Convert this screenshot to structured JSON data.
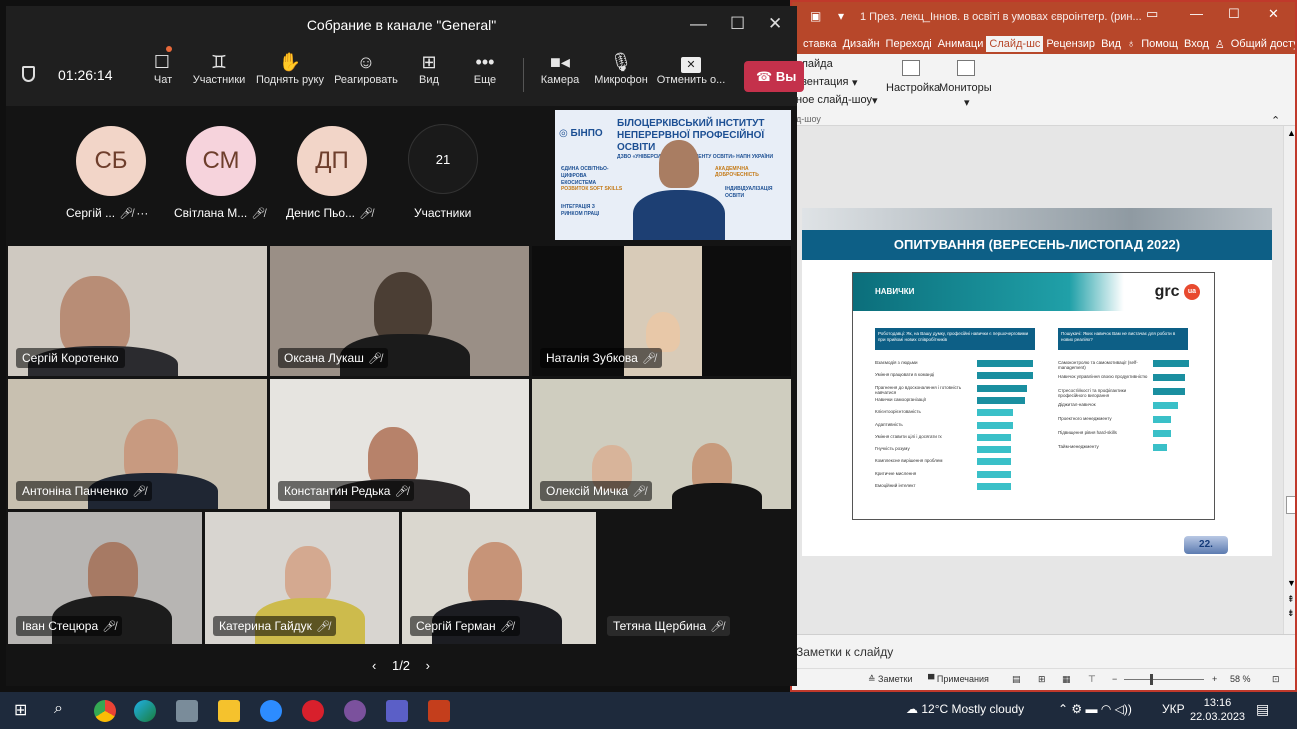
{
  "teams": {
    "title": "Собрание в канале \"General\"",
    "timer": "01:26:14",
    "toolbar": {
      "chat": "Чат",
      "participants": "Участники",
      "raise_hand": "Поднять руку",
      "react": "Реагировать",
      "view": "Вид",
      "more": "Еще",
      "camera": "Камера",
      "mic": "Микрофон",
      "share": "Отменить о...",
      "leave": "Вы"
    },
    "avatars": [
      {
        "initials": "СБ",
        "name": "Сергій ...",
        "color": "#f2d5c8"
      },
      {
        "initials": "СМ",
        "name": "Світлана М...",
        "color": "#f6d3dc"
      },
      {
        "initials": "ДП",
        "name": "Денис Пьо...",
        "color": "#f2d5c8"
      }
    ],
    "overflow": {
      "count": "21",
      "label": "Участники"
    },
    "banner": {
      "org_short": "БІНПО",
      "org_line1": "БІЛОЦЕРКІВСЬКИЙ ІНСТИТУТ",
      "org_line2": "НЕПЕРЕРВНОЇ ПРОФЕСІЙНОЇ ОСВІТИ",
      "org_line3": "ДЗВО «УНІВЕРСИТЕТ МЕНЕДЖМЕНТУ ОСВІТИ» НАПН УКРАЇНИ",
      "tags": [
        "ЄДИНА ОСВІТНЬО-ЦИФРОВА ЕКОСИСТЕМА",
        "РОЗВИТОК SOFT SKILLS",
        "ІНТЕГРАЦІЯ З РИНКОМ ПРАЦІ",
        "ІНДИВІДУАЛІЗАЦІЯ ОСВІТИ",
        "АКАДЕМІЧНА ДОБРОЧЕСНІСТЬ"
      ]
    },
    "tiles": [
      {
        "name": "Сергій Коротенко",
        "muted": false
      },
      {
        "name": "Оксана Лукаш",
        "muted": true
      },
      {
        "name": "Наталія Зубкова",
        "muted": true
      },
      {
        "name": "Антоніна Панченко",
        "muted": true
      },
      {
        "name": "Константин Редька",
        "muted": true
      },
      {
        "name": "Олексій Мичка",
        "muted": true
      },
      {
        "name": "Іван Стецюра",
        "muted": true
      },
      {
        "name": "Катерина Гайдук",
        "muted": true
      },
      {
        "name": "Сергій Герман",
        "muted": true
      },
      {
        "name": "Тетяна Щербина",
        "muted": true
      }
    ],
    "pager": "1/2"
  },
  "ppt": {
    "title": "1 През. лекц_Іннов. в освіті в умовах євроінтегр. (рин...",
    "tabs": [
      "ставка",
      "Дизайн",
      "Переході",
      "Анимаци",
      "Слайд-шс",
      "Рецензир",
      "Вид",
      "Помощ",
      "Вход",
      "Общий доступ"
    ],
    "active_tab": "Слайд-шс",
    "ribbon": {
      "item1": "слайда",
      "item2": "езентация",
      "item3": "ное слайд-шоу",
      "group": "д-шоу",
      "setup": "Настройка",
      "monitors": "Мониторы"
    },
    "slide": {
      "title": "ОПИТУВАННЯ (ВЕРЕСЕНЬ-ЛИСТОПАД 2022)",
      "section": "НАВИЧКИ",
      "logo": "grc",
      "logo_badge": "ua",
      "q_left": "Роботодавці: Як, на Вашу думку, професійні навички є першочерговими при прийомі нових співробітників",
      "q_right": "Пошукачі: Яких навичок Вам не вистачає для роботи в нових реаліях?",
      "left_items": [
        "Взаємодія з людьми",
        "Уміння працювати в команді",
        "Прагнення до вдосконалення і готовність навчатися",
        "Навички самоорганізації",
        "Клієнтоорієнтованість",
        "Адаптивність",
        "Уміння ставити цілі і досягати їх",
        "Гнучкість розуму",
        "Комплексне вирішення проблем",
        "Критичне мислення",
        "Емоційний інтелект"
      ],
      "left_values": [
        0.7,
        0.7,
        0.62,
        0.6,
        0.45,
        0.45,
        0.43,
        0.43,
        0.43,
        0.43,
        0.43
      ],
      "right_items": [
        "Самоконтролю та самомотивації (self-management)",
        "Навичок управління своєю продуктивністю",
        "Стресостійкості та профілактики професійного вигорання",
        "Діджитал-навичок",
        "Проектного менеджменту",
        "Підвищення рівня hard-skills",
        "Тайм-менеджменту"
      ],
      "right_values": [
        0.8,
        0.7,
        0.7,
        0.55,
        0.4,
        0.4,
        0.32
      ],
      "page": "22."
    },
    "notes": "Заметки к слайду",
    "status": {
      "notes": "Заметки",
      "comments": "Примечания",
      "zoom": "58 %"
    }
  },
  "taskbar": {
    "weather": "12°C  Mostly cloudy",
    "lang": "УКР",
    "time": "13:16",
    "date": "22.03.2023"
  }
}
